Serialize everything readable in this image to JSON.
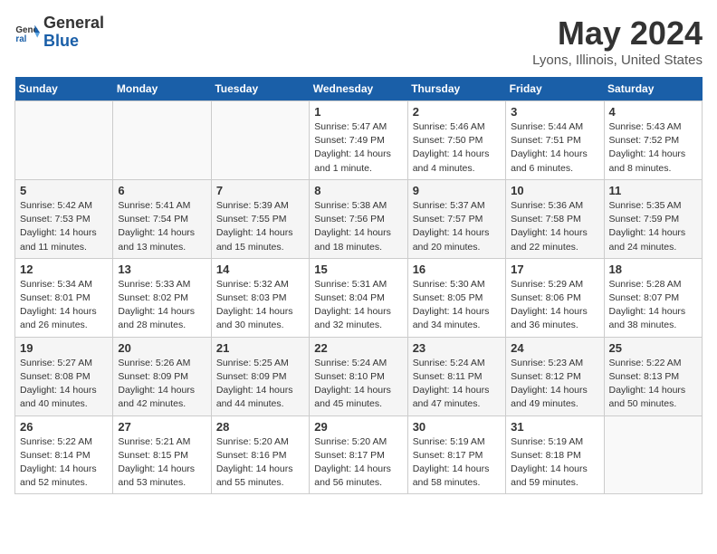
{
  "header": {
    "logo_general": "General",
    "logo_blue": "Blue",
    "month_year": "May 2024",
    "location": "Lyons, Illinois, United States"
  },
  "days_of_week": [
    "Sunday",
    "Monday",
    "Tuesday",
    "Wednesday",
    "Thursday",
    "Friday",
    "Saturday"
  ],
  "weeks": [
    [
      {
        "day": "",
        "info": ""
      },
      {
        "day": "",
        "info": ""
      },
      {
        "day": "",
        "info": ""
      },
      {
        "day": "1",
        "info": "Sunrise: 5:47 AM\nSunset: 7:49 PM\nDaylight: 14 hours and 1 minute."
      },
      {
        "day": "2",
        "info": "Sunrise: 5:46 AM\nSunset: 7:50 PM\nDaylight: 14 hours and 4 minutes."
      },
      {
        "day": "3",
        "info": "Sunrise: 5:44 AM\nSunset: 7:51 PM\nDaylight: 14 hours and 6 minutes."
      },
      {
        "day": "4",
        "info": "Sunrise: 5:43 AM\nSunset: 7:52 PM\nDaylight: 14 hours and 8 minutes."
      }
    ],
    [
      {
        "day": "5",
        "info": "Sunrise: 5:42 AM\nSunset: 7:53 PM\nDaylight: 14 hours and 11 minutes."
      },
      {
        "day": "6",
        "info": "Sunrise: 5:41 AM\nSunset: 7:54 PM\nDaylight: 14 hours and 13 minutes."
      },
      {
        "day": "7",
        "info": "Sunrise: 5:39 AM\nSunset: 7:55 PM\nDaylight: 14 hours and 15 minutes."
      },
      {
        "day": "8",
        "info": "Sunrise: 5:38 AM\nSunset: 7:56 PM\nDaylight: 14 hours and 18 minutes."
      },
      {
        "day": "9",
        "info": "Sunrise: 5:37 AM\nSunset: 7:57 PM\nDaylight: 14 hours and 20 minutes."
      },
      {
        "day": "10",
        "info": "Sunrise: 5:36 AM\nSunset: 7:58 PM\nDaylight: 14 hours and 22 minutes."
      },
      {
        "day": "11",
        "info": "Sunrise: 5:35 AM\nSunset: 7:59 PM\nDaylight: 14 hours and 24 minutes."
      }
    ],
    [
      {
        "day": "12",
        "info": "Sunrise: 5:34 AM\nSunset: 8:01 PM\nDaylight: 14 hours and 26 minutes."
      },
      {
        "day": "13",
        "info": "Sunrise: 5:33 AM\nSunset: 8:02 PM\nDaylight: 14 hours and 28 minutes."
      },
      {
        "day": "14",
        "info": "Sunrise: 5:32 AM\nSunset: 8:03 PM\nDaylight: 14 hours and 30 minutes."
      },
      {
        "day": "15",
        "info": "Sunrise: 5:31 AM\nSunset: 8:04 PM\nDaylight: 14 hours and 32 minutes."
      },
      {
        "day": "16",
        "info": "Sunrise: 5:30 AM\nSunset: 8:05 PM\nDaylight: 14 hours and 34 minutes."
      },
      {
        "day": "17",
        "info": "Sunrise: 5:29 AM\nSunset: 8:06 PM\nDaylight: 14 hours and 36 minutes."
      },
      {
        "day": "18",
        "info": "Sunrise: 5:28 AM\nSunset: 8:07 PM\nDaylight: 14 hours and 38 minutes."
      }
    ],
    [
      {
        "day": "19",
        "info": "Sunrise: 5:27 AM\nSunset: 8:08 PM\nDaylight: 14 hours and 40 minutes."
      },
      {
        "day": "20",
        "info": "Sunrise: 5:26 AM\nSunset: 8:09 PM\nDaylight: 14 hours and 42 minutes."
      },
      {
        "day": "21",
        "info": "Sunrise: 5:25 AM\nSunset: 8:09 PM\nDaylight: 14 hours and 44 minutes."
      },
      {
        "day": "22",
        "info": "Sunrise: 5:24 AM\nSunset: 8:10 PM\nDaylight: 14 hours and 45 minutes."
      },
      {
        "day": "23",
        "info": "Sunrise: 5:24 AM\nSunset: 8:11 PM\nDaylight: 14 hours and 47 minutes."
      },
      {
        "day": "24",
        "info": "Sunrise: 5:23 AM\nSunset: 8:12 PM\nDaylight: 14 hours and 49 minutes."
      },
      {
        "day": "25",
        "info": "Sunrise: 5:22 AM\nSunset: 8:13 PM\nDaylight: 14 hours and 50 minutes."
      }
    ],
    [
      {
        "day": "26",
        "info": "Sunrise: 5:22 AM\nSunset: 8:14 PM\nDaylight: 14 hours and 52 minutes."
      },
      {
        "day": "27",
        "info": "Sunrise: 5:21 AM\nSunset: 8:15 PM\nDaylight: 14 hours and 53 minutes."
      },
      {
        "day": "28",
        "info": "Sunrise: 5:20 AM\nSunset: 8:16 PM\nDaylight: 14 hours and 55 minutes."
      },
      {
        "day": "29",
        "info": "Sunrise: 5:20 AM\nSunset: 8:17 PM\nDaylight: 14 hours and 56 minutes."
      },
      {
        "day": "30",
        "info": "Sunrise: 5:19 AM\nSunset: 8:17 PM\nDaylight: 14 hours and 58 minutes."
      },
      {
        "day": "31",
        "info": "Sunrise: 5:19 AM\nSunset: 8:18 PM\nDaylight: 14 hours and 59 minutes."
      },
      {
        "day": "",
        "info": ""
      }
    ]
  ]
}
